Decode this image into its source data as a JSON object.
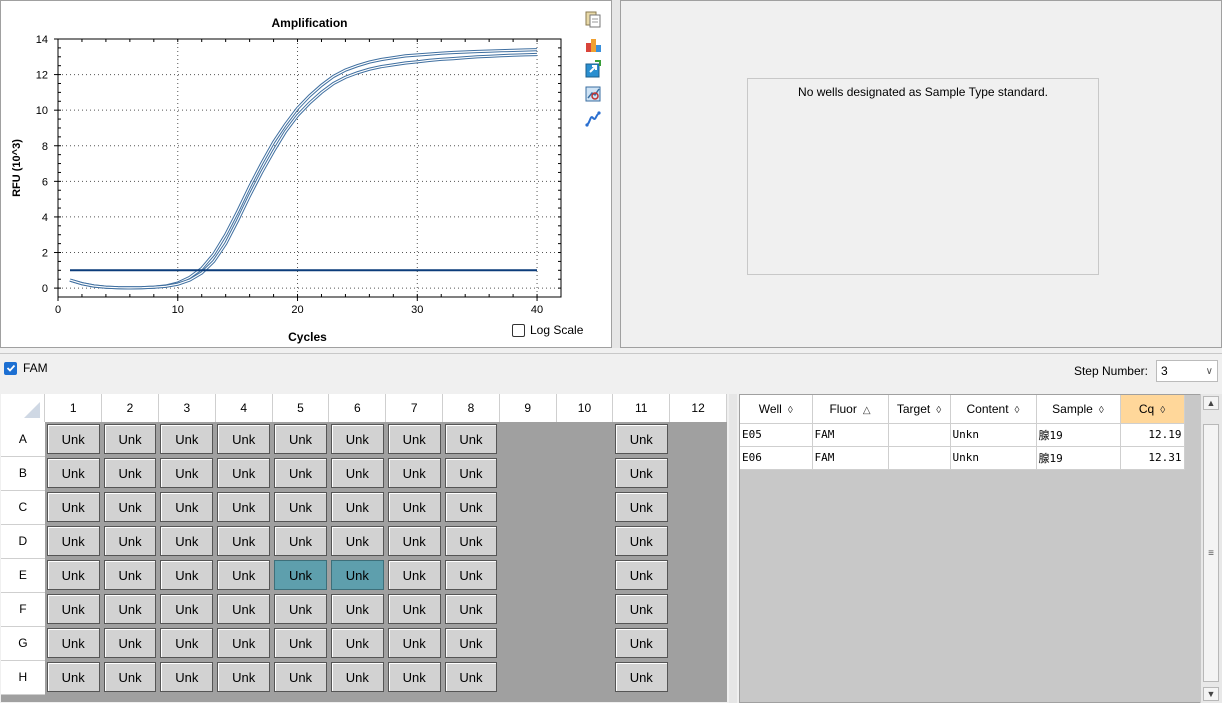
{
  "chart_data": {
    "type": "line",
    "title": "Amplification",
    "xlabel": "Cycles",
    "ylabel": "RFU (10^3)",
    "xlim": [
      0,
      42
    ],
    "ylim": [
      -0.5,
      14
    ],
    "x_ticks": [
      "0",
      "10",
      "20",
      "30",
      "40"
    ],
    "y_ticks": [
      "0",
      "2",
      "4",
      "6",
      "8",
      "10",
      "12",
      "14"
    ],
    "grid": true,
    "series": [
      {
        "x": [
          1,
          2,
          3,
          4,
          5,
          6,
          7,
          8,
          9,
          10,
          11,
          12,
          13,
          14,
          15,
          16,
          17,
          18,
          19,
          20,
          21,
          22,
          23,
          24,
          25,
          26,
          27,
          28,
          29,
          30,
          31,
          32,
          33,
          34,
          35,
          36,
          37,
          38,
          39,
          40
        ],
        "values": [
          0.45,
          0.25,
          0.12,
          0.05,
          0.02,
          0.01,
          0.02,
          0.05,
          0.12,
          0.28,
          0.6,
          1.1,
          1.9,
          3.0,
          4.3,
          5.7,
          7.0,
          8.2,
          9.2,
          10.1,
          10.8,
          11.4,
          11.9,
          12.25,
          12.5,
          12.7,
          12.85,
          12.95,
          13.05,
          13.1,
          13.15,
          13.2,
          13.24,
          13.27,
          13.3,
          13.32,
          13.34,
          13.36,
          13.38,
          13.4
        ]
      },
      {
        "x": [
          1,
          2,
          3,
          4,
          5,
          6,
          7,
          8,
          9,
          10,
          11,
          12,
          13,
          14,
          15,
          16,
          17,
          18,
          19,
          20,
          21,
          22,
          23,
          24,
          25,
          26,
          27,
          28,
          29,
          30,
          31,
          32,
          33,
          34,
          35,
          36,
          37,
          38,
          39,
          40
        ],
        "values": [
          0.45,
          0.25,
          0.12,
          0.05,
          0.02,
          0.01,
          0.02,
          0.05,
          0.1,
          0.22,
          0.45,
          0.85,
          1.5,
          2.5,
          3.8,
          5.2,
          6.5,
          7.7,
          8.8,
          9.7,
          10.4,
          11.0,
          11.5,
          11.85,
          12.1,
          12.3,
          12.45,
          12.55,
          12.65,
          12.72,
          12.8,
          12.86,
          12.9,
          12.95,
          13.0,
          13.03,
          13.06,
          13.09,
          13.11,
          13.13
        ]
      },
      {
        "x": [
          1,
          40
        ],
        "values": [
          1.0,
          1.0
        ]
      }
    ],
    "series_colors": [
      "#3f6fa0",
      "#3f6fa0",
      "#0b3c7a"
    ]
  },
  "chart_panel": {
    "log_scale_label": "Log Scale"
  },
  "standard_panel": {
    "message": "No wells designated as Sample Type standard."
  },
  "fam_bar": {
    "label": "FAM",
    "step_label": "Step Number:",
    "step_value": "3"
  },
  "plate": {
    "columns": [
      "1",
      "2",
      "3",
      "4",
      "5",
      "6",
      "7",
      "8",
      "9",
      "10",
      "11",
      "12"
    ],
    "rows": [
      "A",
      "B",
      "C",
      "D",
      "E",
      "F",
      "G",
      "H"
    ],
    "well_label": "Unk",
    "filled_columns": [
      1,
      2,
      3,
      4,
      5,
      6,
      7,
      8,
      11
    ],
    "selected_wells": [
      "E5",
      "E6"
    ]
  },
  "results_table": {
    "headers": [
      "Well",
      "Fluor",
      "Target",
      "Content",
      "Sample",
      "Cq"
    ],
    "sort_icons": [
      "◊",
      "△",
      "◊",
      "◊",
      "◊",
      "◊"
    ],
    "rows": [
      [
        "E05",
        "FAM",
        "",
        "Unkn",
        "腺19",
        "12.19"
      ],
      [
        "E06",
        "FAM",
        "",
        "Unkn",
        "腺19",
        "12.31"
      ]
    ]
  }
}
